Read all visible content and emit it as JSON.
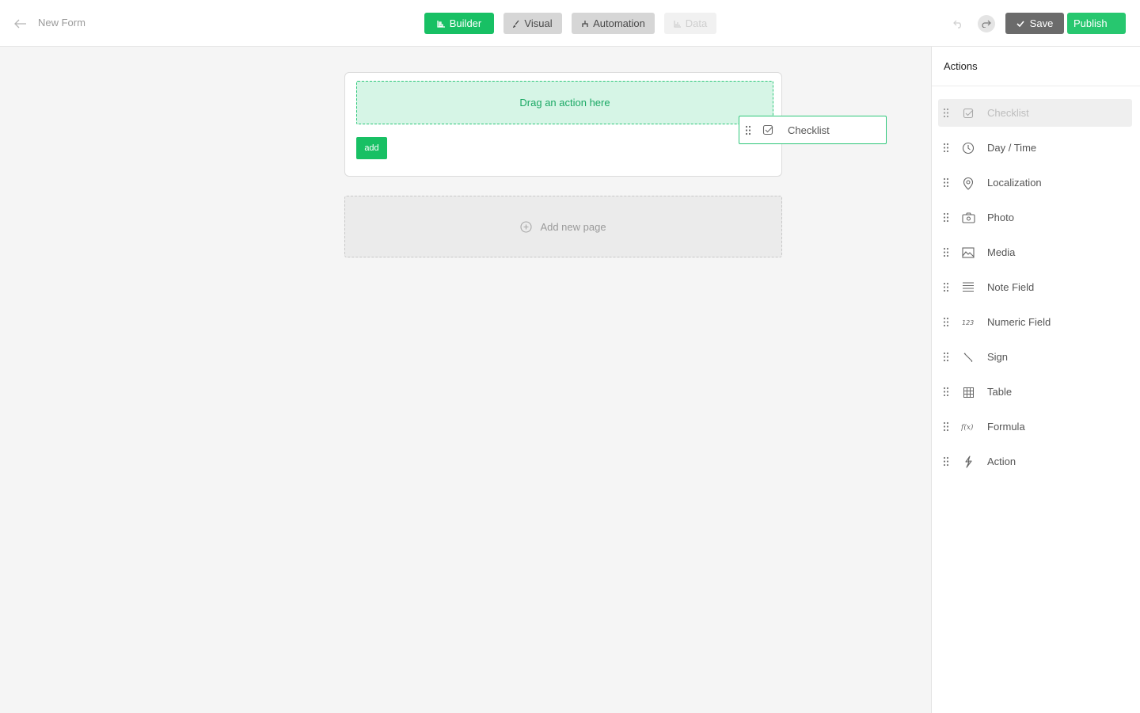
{
  "header": {
    "title": "New Form",
    "tabs": {
      "builder": "Builder",
      "visual": "Visual",
      "automation": "Automation",
      "data": "Data"
    },
    "save_label": "Save",
    "publish_label": "Publish"
  },
  "canvas": {
    "drop_zone_text": "Drag an action here",
    "add_button_label": "add",
    "add_page_label": "Add new page"
  },
  "drag_ghost": {
    "label": "Checklist",
    "icon": "checklist-icon"
  },
  "sidebar": {
    "title": "Actions",
    "items": [
      {
        "label": "Checklist",
        "icon": "checklist-icon"
      },
      {
        "label": "Day / Time",
        "icon": "clock-icon"
      },
      {
        "label": "Localization",
        "icon": "location-pin-icon"
      },
      {
        "label": "Photo",
        "icon": "camera-icon"
      },
      {
        "label": "Media",
        "icon": "image-icon"
      },
      {
        "label": "Note Field",
        "icon": "note-lines-icon"
      },
      {
        "label": "Numeric Field",
        "icon": "numeric-123-icon"
      },
      {
        "label": "Sign",
        "icon": "pen-sign-icon"
      },
      {
        "label": "Table",
        "icon": "table-grid-icon"
      },
      {
        "label": "Formula",
        "icon": "formula-fx-icon"
      },
      {
        "label": "Action",
        "icon": "lightning-icon"
      }
    ]
  },
  "colors": {
    "accent": "#18c064",
    "drop_zone_bg": "#d6f5e6",
    "save_bg": "#6b6b6b"
  }
}
